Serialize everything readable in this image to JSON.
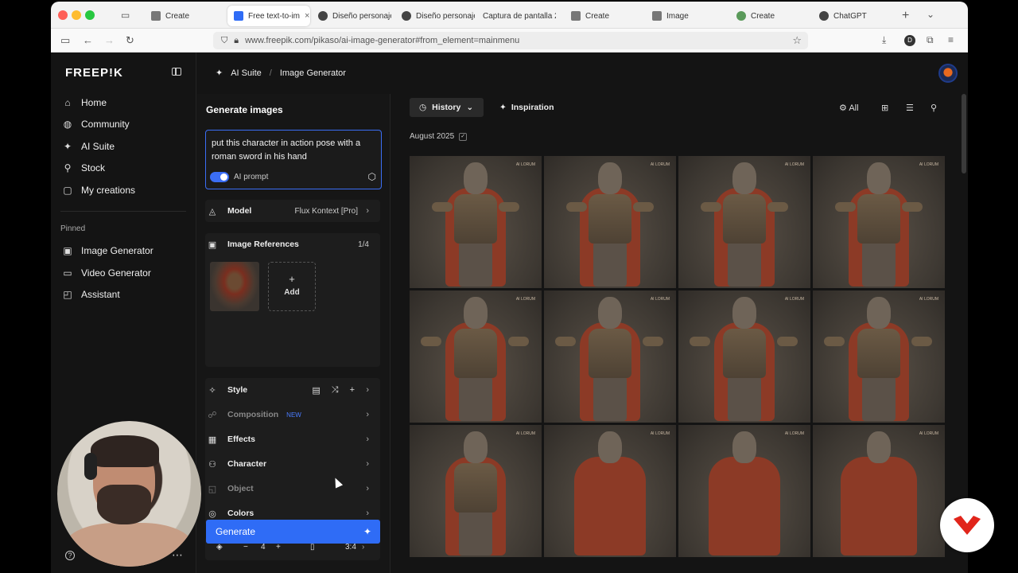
{
  "browser": {
    "tabs": [
      {
        "label": "Create",
        "icon": "freepik-favicon",
        "color": "#777777"
      },
      {
        "label": "Free text-to-im",
        "icon": "freepik-favicon-blue",
        "color": "#2f6cf6",
        "active": true
      },
      {
        "label": "Diseño personaje",
        "icon": "chatgpt-favicon",
        "color": "#444444"
      },
      {
        "label": "Diseño personaje",
        "icon": "chatgpt-favicon",
        "color": "#444444"
      },
      {
        "label": "Captura de pantalla 2(",
        "icon": "none",
        "color": "#f3f3f3"
      },
      {
        "label": "Create",
        "icon": "freepik-favicon",
        "color": "#777777"
      },
      {
        "label": "Image",
        "icon": "freepik-favicon",
        "color": "#777777"
      },
      {
        "label": "Create",
        "icon": "green-favicon",
        "color": "#5a9a5a"
      },
      {
        "label": "ChatGPT",
        "icon": "chatgpt-favicon",
        "color": "#444444"
      }
    ],
    "url": "www.freepik.com/pikaso/ai-image-generator#from_element=mainmenu",
    "profile_initial": "D"
  },
  "sidebar": {
    "logo": "FREEP!K",
    "items": [
      {
        "label": "Home",
        "icon": "home-icon"
      },
      {
        "label": "Community",
        "icon": "globe-icon"
      },
      {
        "label": "AI Suite",
        "icon": "sparkle-icon"
      },
      {
        "label": "Stock",
        "icon": "search-icon"
      },
      {
        "label": "My creations",
        "icon": "folder-icon"
      }
    ],
    "pinned_label": "Pinned",
    "pinned": [
      {
        "label": "Image Generator",
        "icon": "image-icon"
      },
      {
        "label": "Video Generator",
        "icon": "video-icon"
      },
      {
        "label": "Assistant",
        "icon": "chat-icon"
      }
    ]
  },
  "header": {
    "breadcrumb": [
      "AI Suite",
      "Image Generator"
    ]
  },
  "generator": {
    "title": "Generate images",
    "prompt": "put this character in action pose with a roman sword in his hand",
    "ai_prompt_label": "AI prompt",
    "ai_prompt_enabled": true,
    "model_label": "Model",
    "model_value": "Flux Kontext [Pro]",
    "image_refs_label": "Image References",
    "image_refs_count": "1/4",
    "add_label": "Add",
    "style_label": "Style",
    "composition_label": "Composition",
    "new_badge": "NEW",
    "effects_label": "Effects",
    "character_label": "Character",
    "object_label": "Object",
    "colors_label": "Colors",
    "quantity": "4",
    "aspect_ratio": "3:4",
    "generate_label": "Generate"
  },
  "main": {
    "history_label": "History",
    "inspiration_label": "Inspiration",
    "all_label": "All",
    "date_group": "August 2025",
    "tile_tag": "AI LORUM"
  },
  "colors": {
    "accent": "#2f6cf6",
    "background": "#141414",
    "brand_badge": "#e1251b"
  }
}
